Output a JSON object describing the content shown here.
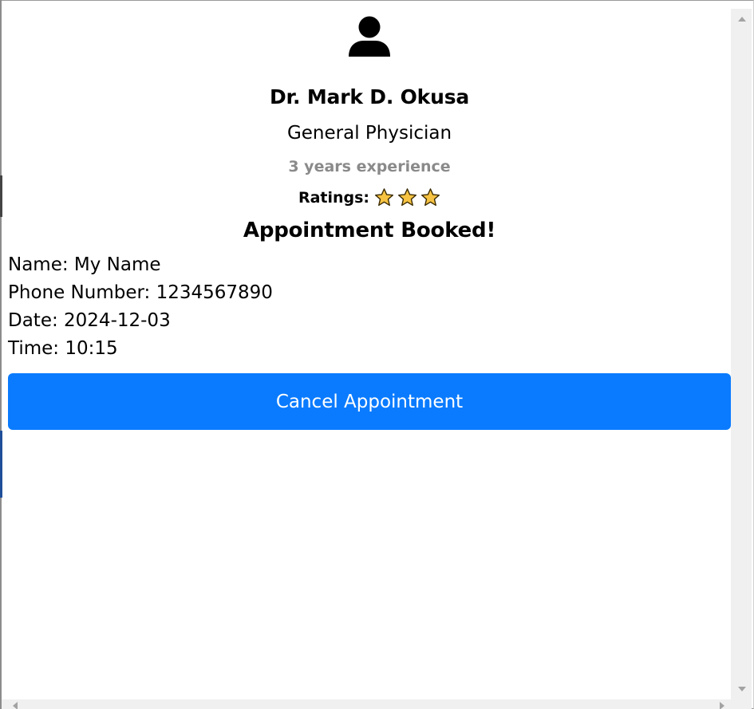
{
  "doctor": {
    "name": "Dr. Mark D. Okusa",
    "specialty": "General Physician",
    "experience": "3 years experience",
    "ratings_label": "Ratings:",
    "rating_stars": 3
  },
  "status_title": "Appointment Booked!",
  "details": {
    "name": "Name: My Name",
    "phone": "Phone Number: 1234567890",
    "date": "Date: 2024-12-03",
    "time": "Time: 10:15"
  },
  "actions": {
    "cancel_label": "Cancel Appointment"
  },
  "icons": {
    "profile": "user-icon",
    "star": "star-icon"
  },
  "colors": {
    "button": "#0a7bff",
    "star_fill": "#f7c342",
    "muted_text": "#8a8a8a"
  }
}
